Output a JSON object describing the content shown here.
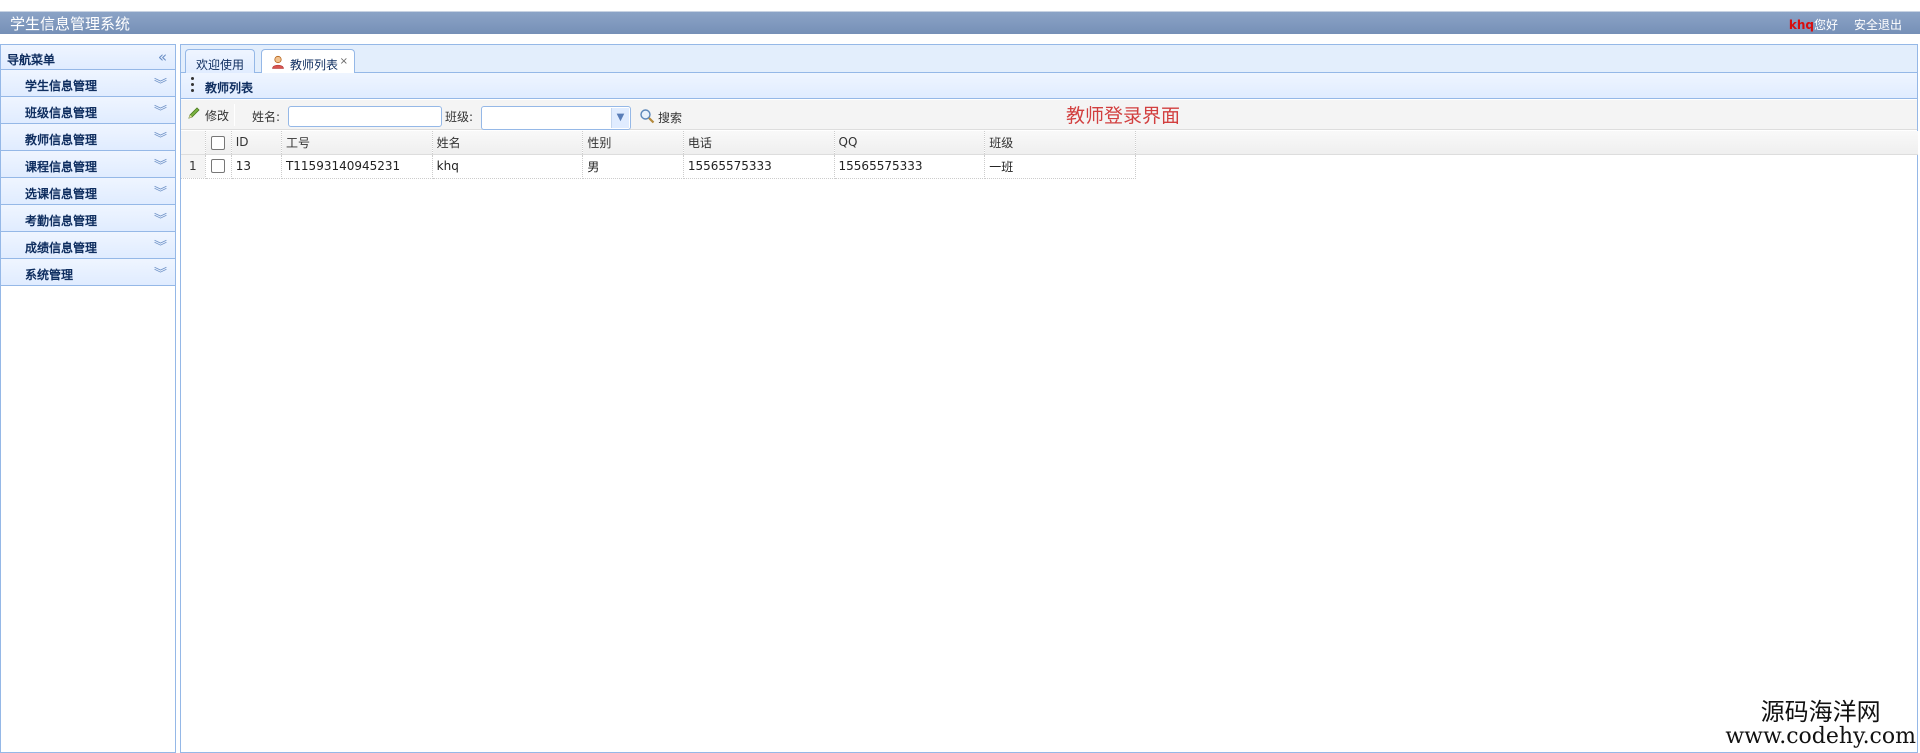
{
  "header": {
    "app_title": "学生信息管理系统",
    "username": "khq",
    "greeting": "您好",
    "logout": "安全退出"
  },
  "sidebar": {
    "title": "导航菜单",
    "items": [
      {
        "label": "学生信息管理"
      },
      {
        "label": "班级信息管理"
      },
      {
        "label": "教师信息管理"
      },
      {
        "label": "课程信息管理"
      },
      {
        "label": "选课信息管理"
      },
      {
        "label": "考勤信息管理"
      },
      {
        "label": "成绩信息管理"
      },
      {
        "label": "系统管理"
      }
    ]
  },
  "tabs": [
    {
      "label": "欢迎使用",
      "active": false
    },
    {
      "label": "教师列表",
      "active": true,
      "closable": true,
      "close_glyph": "×"
    }
  ],
  "panel": {
    "title": "教师列表"
  },
  "toolbar": {
    "edit_label": "修改",
    "name_label": "姓名:",
    "name_value": "",
    "class_label": "班级:",
    "class_value": "",
    "search_label": "搜索"
  },
  "annotation": "教师登录界面",
  "grid": {
    "columns": [
      "ID",
      "工号",
      "姓名",
      "性别",
      "电话",
      "QQ",
      "班级"
    ],
    "rows": [
      {
        "rownum": "1",
        "cells": [
          "13",
          "T11593140945231",
          "khq",
          "男",
          "15565575333",
          "15565575333",
          "一班"
        ]
      }
    ]
  },
  "watermark": {
    "line1": "源码海洋网",
    "line2": "www.codehy.com"
  },
  "colors": {
    "header_bg": "#7e97bd",
    "accent_border": "#95b8e7",
    "username": "#d80d0d",
    "annotation": "#d23f3f"
  }
}
